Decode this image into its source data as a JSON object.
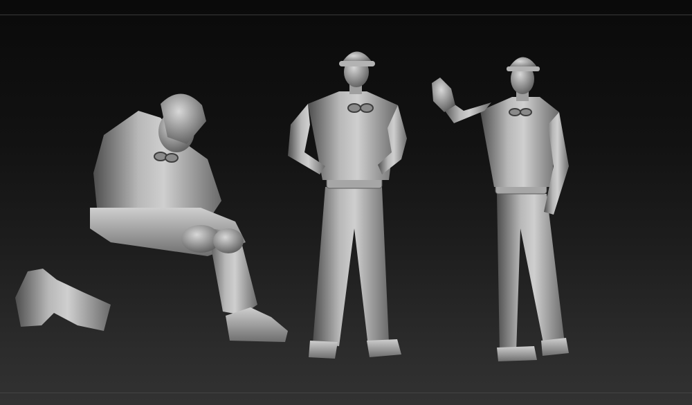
{
  "scene": {
    "figures": [
      {
        "id": "kneeling-worker",
        "pose": "kneeling",
        "headwear": "cap"
      },
      {
        "id": "standing-worker",
        "pose": "hands-on-hips",
        "headwear": "helmet"
      },
      {
        "id": "waving-worker",
        "pose": "raised-hand",
        "headwear": "helmet"
      }
    ]
  },
  "colors": {
    "background_top": "#0a0a0a",
    "background_bottom": "#323232",
    "clay_light": "#d6d6d6",
    "clay_mid": "#9a9a9a",
    "clay_dark": "#4a4a4a"
  }
}
